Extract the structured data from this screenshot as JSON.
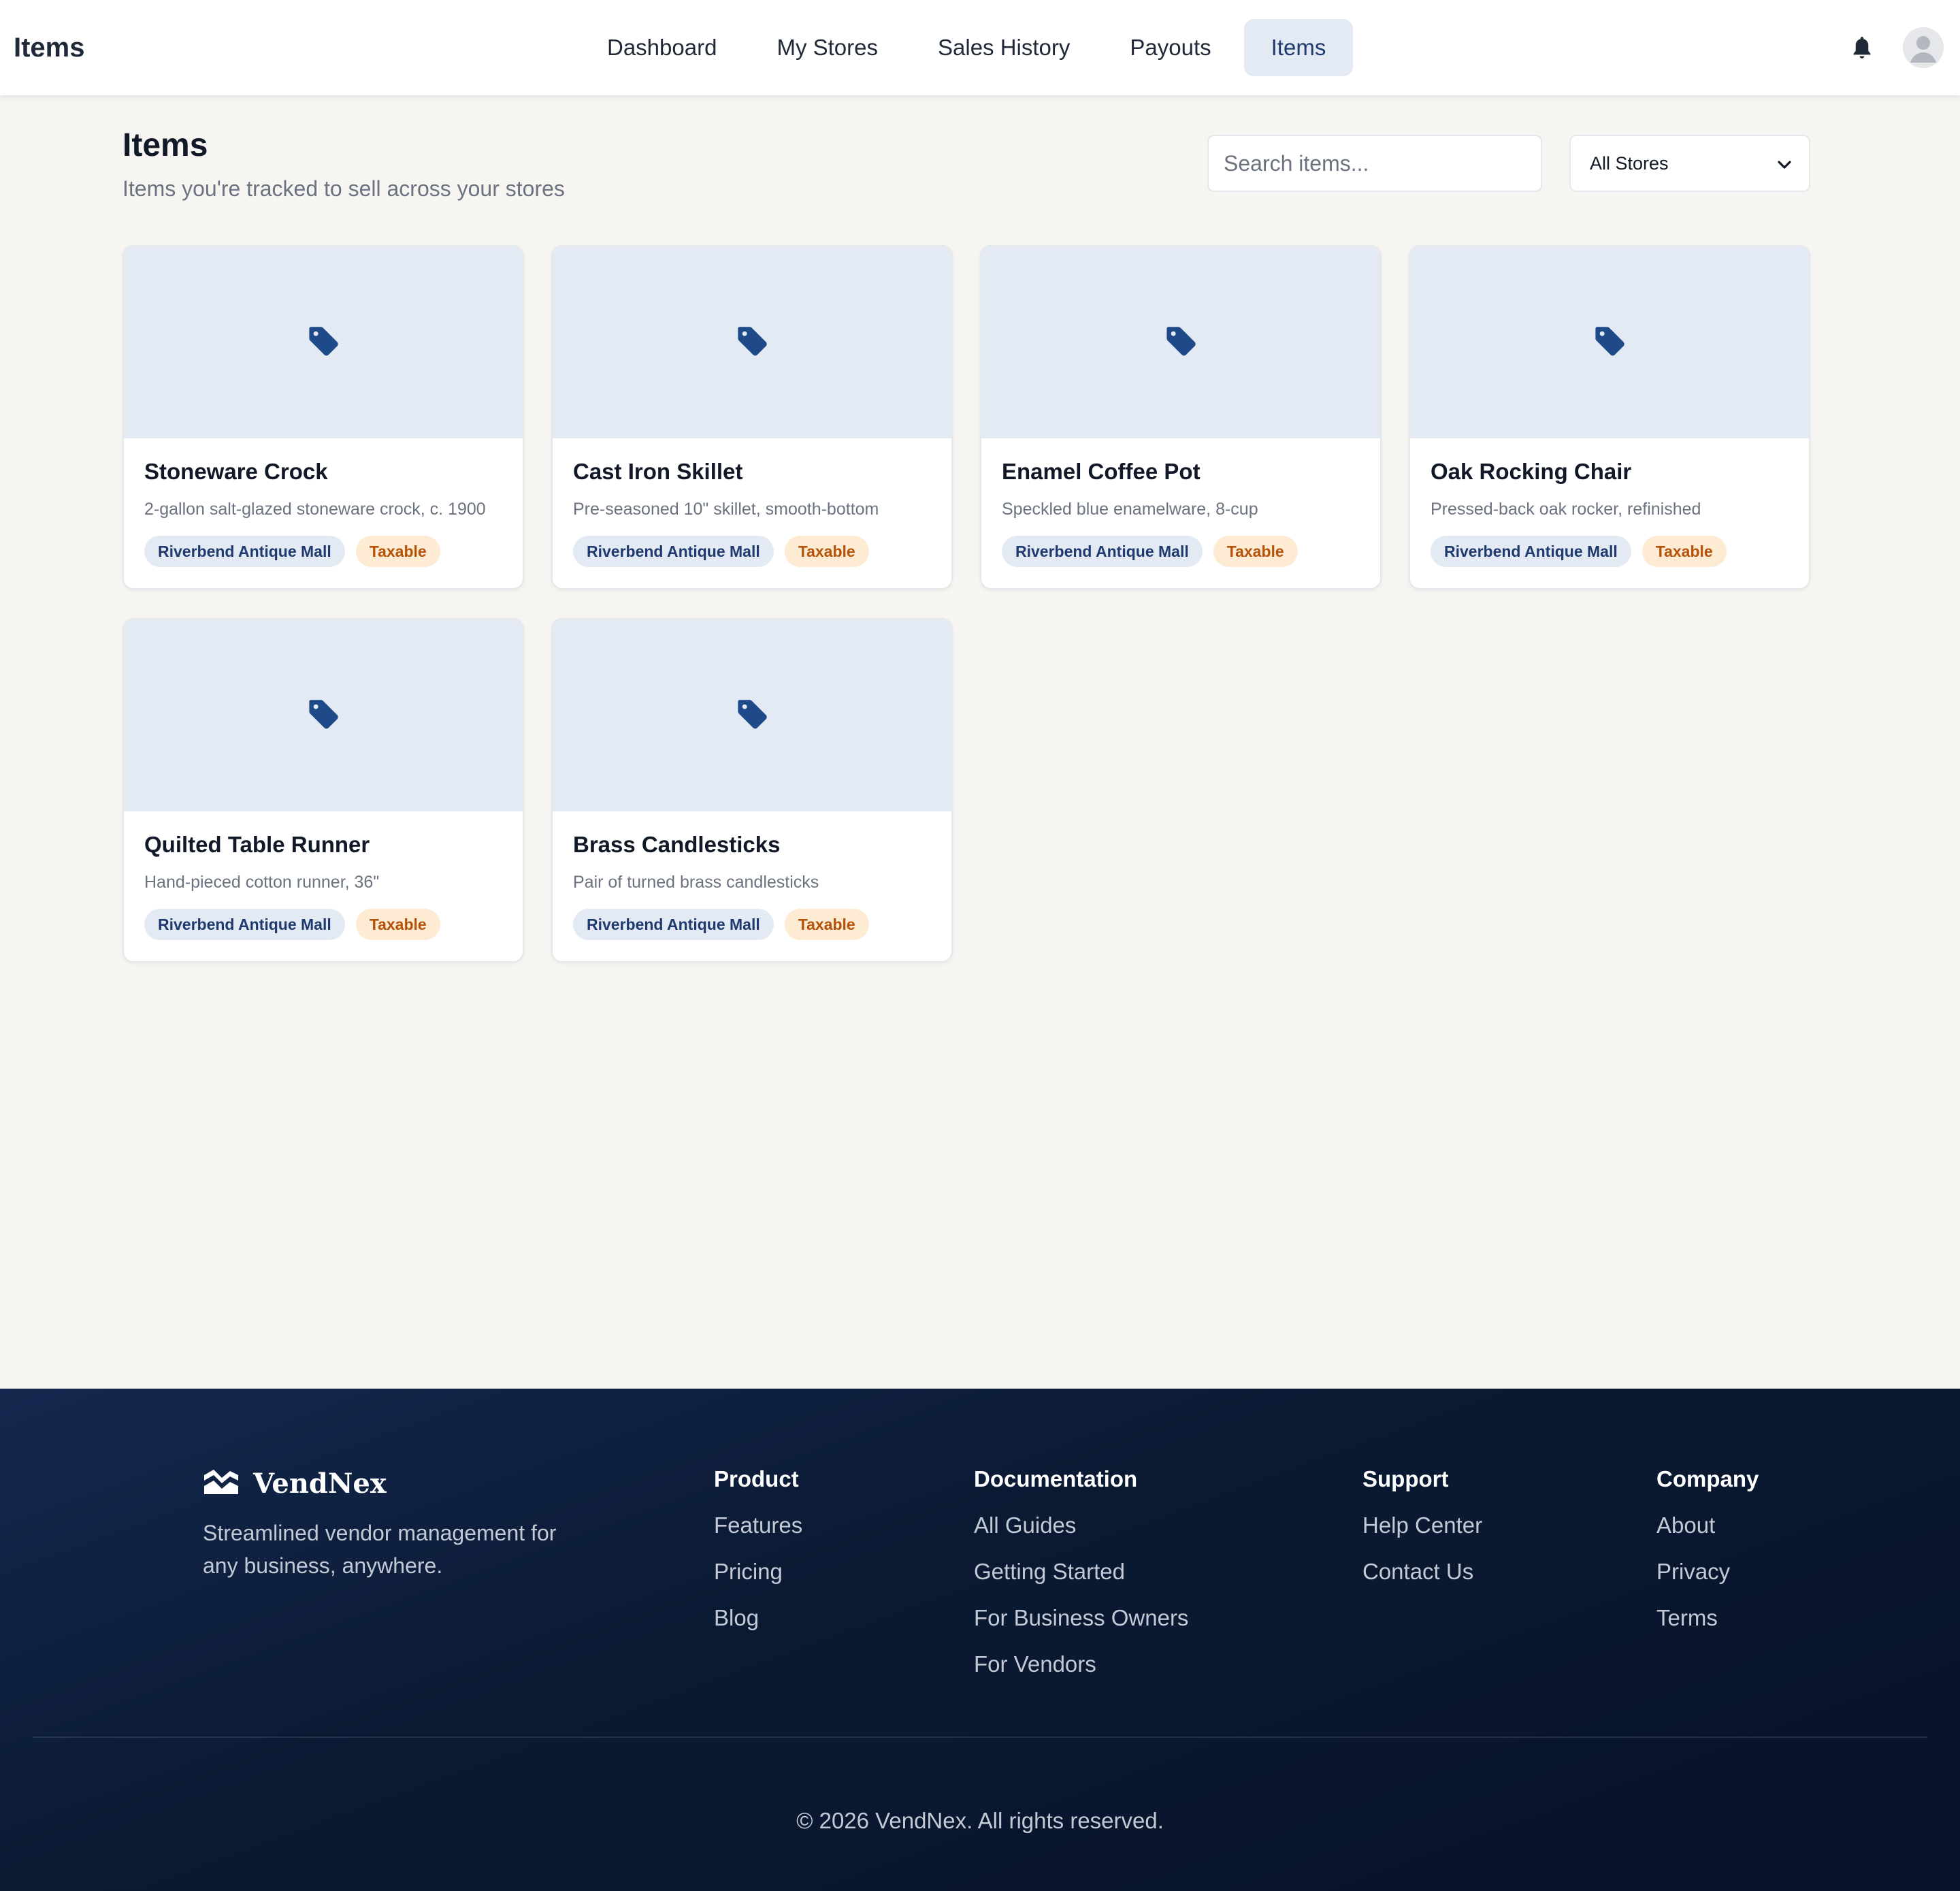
{
  "header": {
    "title": "Items",
    "nav": [
      {
        "label": "Dashboard"
      },
      {
        "label": "My Stores"
      },
      {
        "label": "Sales History"
      },
      {
        "label": "Payouts"
      },
      {
        "label": "Items",
        "active": true
      }
    ],
    "icons": [
      "bell-icon",
      "user-avatar-icon"
    ]
  },
  "main": {
    "title": "Items",
    "subtitle": "Items you're tracked to sell across your stores",
    "search": {
      "placeholder": "Search items...",
      "value": ""
    },
    "store_filter": {
      "selected": "All Stores"
    },
    "items": [
      {
        "name": "Stoneware Crock",
        "description": "2-gallon salt-glazed stoneware crock, c. 1900",
        "store": "Riverbend Antique Mall",
        "tax": "Taxable",
        "icon": "price-tag-icon"
      },
      {
        "name": "Cast Iron Skillet",
        "description": "Pre-seasoned 10\" skillet, smooth-bottom",
        "store": "Riverbend Antique Mall",
        "tax": "Taxable",
        "icon": "price-tag-icon"
      },
      {
        "name": "Enamel Coffee Pot",
        "description": "Speckled blue enamelware, 8-cup",
        "store": "Riverbend Antique Mall",
        "tax": "Taxable",
        "icon": "price-tag-icon"
      },
      {
        "name": "Oak Rocking Chair",
        "description": "Pressed-back oak rocker, refinished",
        "store": "Riverbend Antique Mall",
        "tax": "Taxable",
        "icon": "price-tag-icon"
      },
      {
        "name": "Quilted Table Runner",
        "description": "Hand-pieced cotton runner, 36\"",
        "store": "Riverbend Antique Mall",
        "tax": "Taxable",
        "icon": "price-tag-icon"
      },
      {
        "name": "Brass Candlesticks",
        "description": "Pair of turned brass candlesticks",
        "store": "Riverbend Antique Mall",
        "tax": "Taxable",
        "icon": "price-tag-icon"
      }
    ]
  },
  "footer": {
    "brand": "VendNex",
    "tagline": "Streamlined vendor management for any business, anywhere.",
    "columns": [
      {
        "title": "Product",
        "links": [
          "Features",
          "Pricing",
          "Blog"
        ]
      },
      {
        "title": "Documentation",
        "links": [
          "All Guides",
          "Getting Started",
          "For Business Owners",
          "For Vendors"
        ]
      },
      {
        "title": "Support",
        "links": [
          "Help Center",
          "Contact Us"
        ]
      },
      {
        "title": "Company",
        "links": [
          "About",
          "Privacy",
          "Terms"
        ]
      }
    ],
    "copyright": "© 2026 VendNex. All rights reserved."
  },
  "colors": {
    "accent": "#1e3a6e",
    "tag_icon": "#1e4a8a",
    "taxable_bg": "#fdecd3",
    "taxable_text": "#b45309",
    "footer_bg": "#0b1a33",
    "page_bg": "#f6f5f1"
  }
}
